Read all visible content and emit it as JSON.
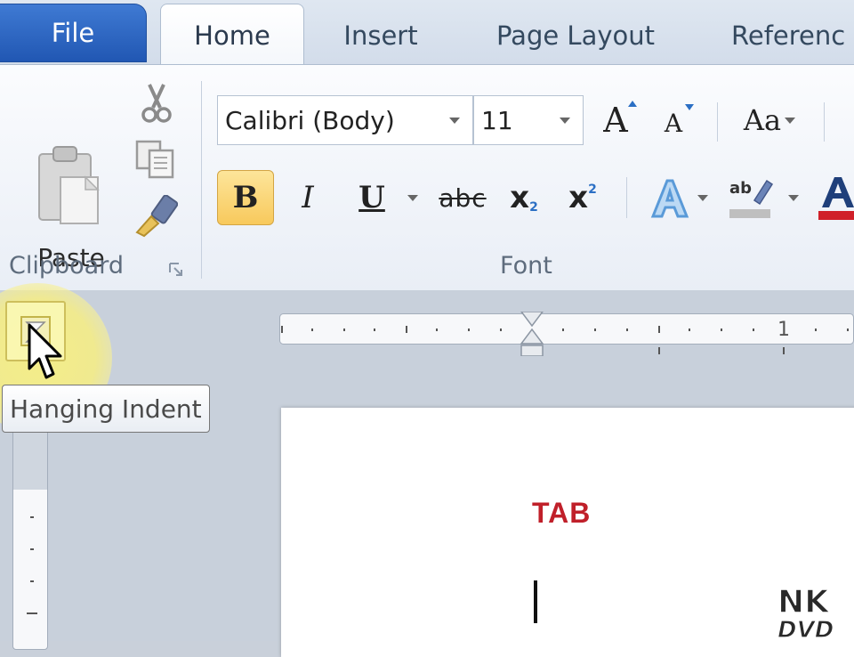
{
  "tabs": {
    "file": "File",
    "home": "Home",
    "insert": "Insert",
    "page_layout": "Page Layout",
    "references": "Referenc"
  },
  "clipboard": {
    "paste_label": "Paste",
    "group_label": "Clipboard",
    "icons": [
      "paste-icon",
      "cut-icon",
      "copy-icon",
      "format-painter-icon",
      "dialog-launcher-icon"
    ]
  },
  "font": {
    "group_label": "Font",
    "font_name": "Calibri (Body)",
    "font_size": "11",
    "bold": "B",
    "italic": "I",
    "underline": "U",
    "strikethrough": "abc",
    "subscript_base": "x",
    "subscript_mark": "2",
    "superscript_base": "x",
    "superscript_mark": "2",
    "change_case": "Aa",
    "grow_font": "A",
    "shrink_font": "A",
    "bold_active": true,
    "font_color": "#d0202a",
    "highlight_color": "#bfbfbf"
  },
  "ruler": {
    "number_1": "1"
  },
  "tooltip": {
    "text": "Hanging Indent"
  },
  "document": {
    "title": "TAB",
    "title_color": "#c0202a"
  },
  "watermark": {
    "top": "NK",
    "bottom": "DVD"
  },
  "colors": {
    "file_tab": "#2a63c2",
    "bold_highlight": "#f9d06c"
  }
}
